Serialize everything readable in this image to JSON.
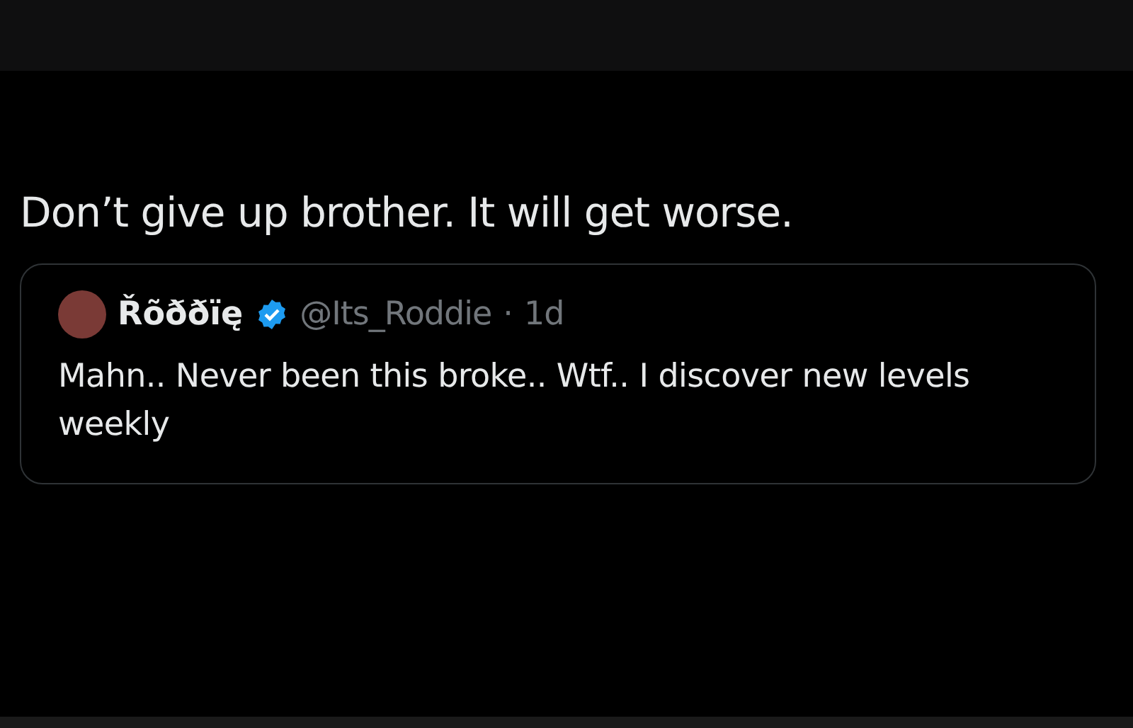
{
  "post": {
    "text": "Don’t give up brother. It will get worse."
  },
  "quoted_post": {
    "name": "Řõððïę",
    "verified": true,
    "handle": "@Its_Roddie",
    "separator": "·",
    "time": "1d",
    "text": "Mahn.. Never been this broke.. Wtf.. I discover new levels weekly"
  }
}
